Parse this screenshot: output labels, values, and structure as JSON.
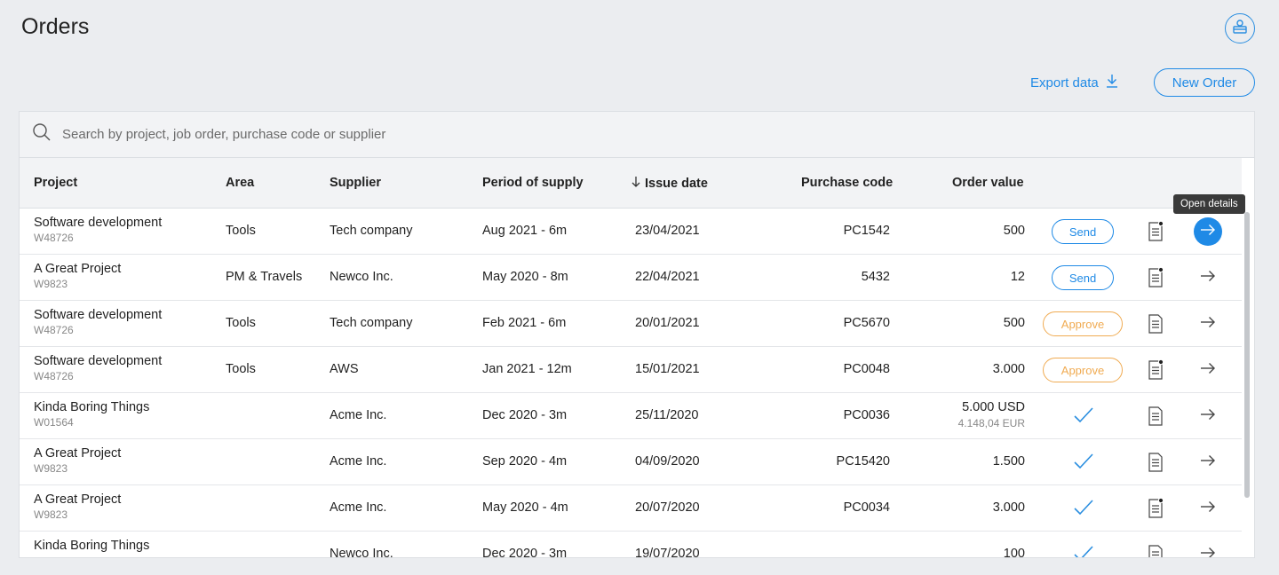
{
  "page": {
    "title": "Orders"
  },
  "actions": {
    "export_label": "Export data",
    "new_order_label": "New Order"
  },
  "search": {
    "placeholder": "Search by project, job order, purchase code or supplier"
  },
  "table": {
    "headers": {
      "project": "Project",
      "area": "Area",
      "supplier": "Supplier",
      "period": "Period of supply",
      "issue_date": "Issue date",
      "purchase_code": "Purchase code",
      "order_value": "Order value"
    },
    "sort": {
      "column": "issue_date",
      "direction": "desc"
    },
    "tooltip": "Open details",
    "rows": [
      {
        "project": "Software development",
        "code": "W48726",
        "area": "Tools",
        "supplier": "Tech company",
        "period": "Aug 2021 - 6m",
        "issue_date": "23/04/2021",
        "purchase_code": "PC1542",
        "value": "500",
        "value_sub": "",
        "action": "send",
        "action_label": "Send",
        "doc_dot": true,
        "active": true
      },
      {
        "project": "A Great Project",
        "code": "W9823",
        "area": "PM & Travels",
        "supplier": "Newco Inc.",
        "period": "May 2020 - 8m",
        "issue_date": "22/04/2021",
        "purchase_code": "5432",
        "value": "12",
        "value_sub": "",
        "action": "send",
        "action_label": "Send",
        "doc_dot": true,
        "active": false
      },
      {
        "project": "Software development",
        "code": "W48726",
        "area": "Tools",
        "supplier": "Tech company",
        "period": "Feb 2021 - 6m",
        "issue_date": "20/01/2021",
        "purchase_code": "PC5670",
        "value": "500",
        "value_sub": "",
        "action": "approve",
        "action_label": "Approve",
        "doc_dot": false,
        "active": false
      },
      {
        "project": "Software development",
        "code": "W48726",
        "area": "Tools",
        "supplier": "AWS",
        "period": "Jan 2021 - 12m",
        "issue_date": "15/01/2021",
        "purchase_code": "PC0048",
        "value": "3.000",
        "value_sub": "",
        "action": "approve",
        "action_label": "Approve",
        "doc_dot": true,
        "active": false
      },
      {
        "project": "Kinda Boring Things",
        "code": "W01564",
        "area": "",
        "supplier": "Acme Inc.",
        "period": "Dec 2020 - 3m",
        "issue_date": "25/11/2020",
        "purchase_code": "PC0036",
        "value": "5.000 USD",
        "value_sub": "4.148,04 EUR",
        "action": "done",
        "action_label": "",
        "doc_dot": false,
        "active": false
      },
      {
        "project": "A Great Project",
        "code": "W9823",
        "area": "",
        "supplier": "Acme Inc.",
        "period": "Sep 2020 - 4m",
        "issue_date": "04/09/2020",
        "purchase_code": "PC15420",
        "value": "1.500",
        "value_sub": "",
        "action": "done",
        "action_label": "",
        "doc_dot": false,
        "active": false
      },
      {
        "project": "A Great Project",
        "code": "W9823",
        "area": "",
        "supplier": "Acme Inc.",
        "period": "May 2020 - 4m",
        "issue_date": "20/07/2020",
        "purchase_code": "PC0034",
        "value": "3.000",
        "value_sub": "",
        "action": "done",
        "action_label": "",
        "doc_dot": true,
        "active": false
      },
      {
        "project": "Kinda Boring Things",
        "code": "",
        "area": "",
        "supplier": "Newco Inc.",
        "period": "Dec 2020 - 3m",
        "issue_date": "19/07/2020",
        "purchase_code": "",
        "value": "100",
        "value_sub": "",
        "action": "done",
        "action_label": "",
        "doc_dot": false,
        "active": false
      }
    ]
  },
  "colors": {
    "accent": "#1f8ae6",
    "approve": "#f0ab52",
    "background": "#ebedf0"
  }
}
